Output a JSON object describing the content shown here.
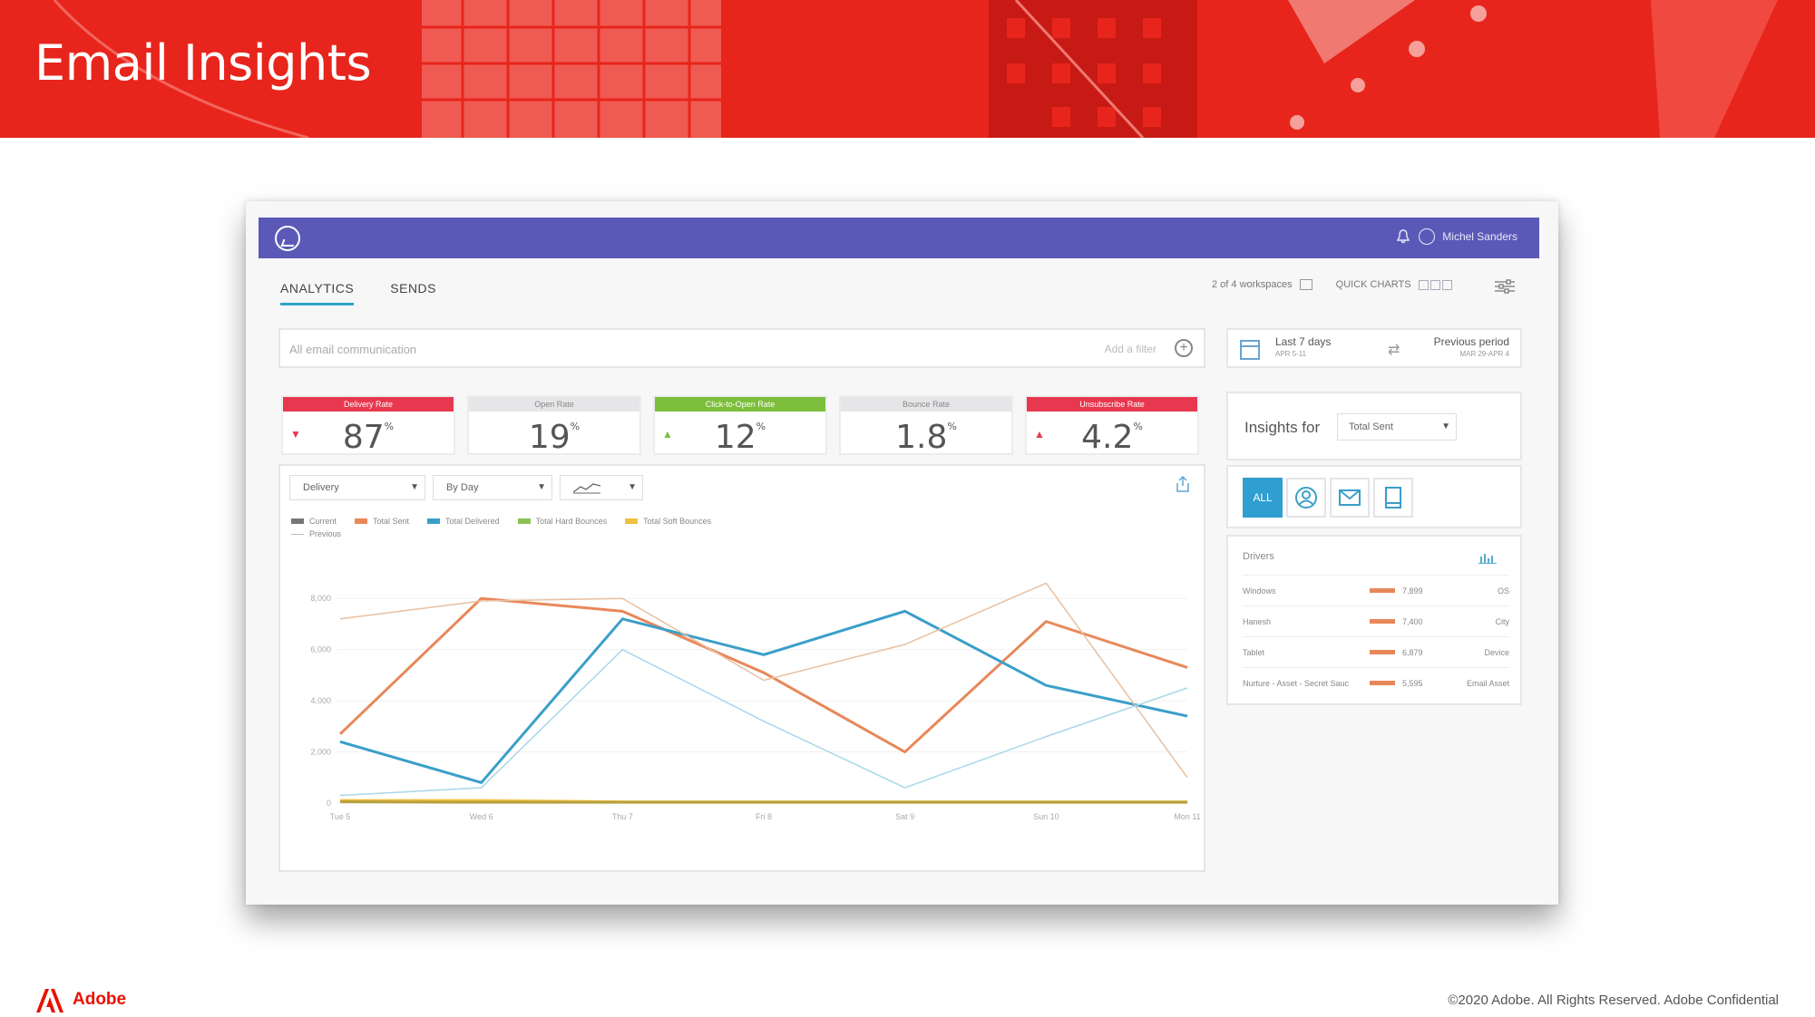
{
  "slide": {
    "title": "Email Insights",
    "brand": "Adobe",
    "copyright": "©2020 Adobe. All Rights Reserved. Adobe Confidential"
  },
  "app": {
    "user": "Michel Sanders",
    "tabs": [
      {
        "label": "ANALYTICS",
        "active": true
      },
      {
        "label": "SENDS",
        "active": false
      }
    ],
    "workspaces": "2 of 4 workspaces",
    "quick_charts": "QUICK CHARTS",
    "filter": {
      "placeholder": "All email communication",
      "add_label": "Add a filter"
    },
    "period": {
      "current": "Last 7 days",
      "current_range": "APR 5-11",
      "previous": "Previous period",
      "previous_range": "MAR 29-APR 4"
    },
    "kpis": [
      {
        "label": "Delivery Rate",
        "value": "87",
        "unit": "%",
        "color": "#e8384f",
        "trend": "down"
      },
      {
        "label": "Open Rate",
        "value": "19",
        "unit": "%",
        "color": "#e6e6e9",
        "trend": ""
      },
      {
        "label": "Click-to-Open Rate",
        "value": "12",
        "unit": "%",
        "color": "#7cbe3b",
        "trend": "up"
      },
      {
        "label": "Bounce Rate",
        "value": "1.8",
        "unit": "%",
        "color": "#e6e6e9",
        "trend": ""
      },
      {
        "label": "Unsubscribe Rate",
        "value": "4.2",
        "unit": "%",
        "color": "#e8384f",
        "trend": "up"
      }
    ],
    "chart_controls": {
      "metric": "Delivery",
      "granularity": "By Day"
    },
    "insights": {
      "label": "Insights for",
      "selected": "Total Sent",
      "all_button": "ALL"
    },
    "drivers": {
      "title": "Drivers",
      "rows": [
        {
          "name": "Windows",
          "value": "7,899",
          "category": "OS"
        },
        {
          "name": "Hanesh",
          "value": "7,400",
          "category": "City"
        },
        {
          "name": "Tablet",
          "value": "6,879",
          "category": "Device"
        },
        {
          "name": "Nurture - Asset - Secret Sauc",
          "value": "5,595",
          "category": "Email Asset"
        }
      ]
    }
  },
  "chart_data": {
    "type": "line",
    "categories": [
      "Tue 5",
      "Wed 6",
      "Thu 7",
      "Fri 8",
      "Sat 9",
      "Sun 10",
      "Mon 11"
    ],
    "ylim": [
      0,
      9000
    ],
    "yticks": [
      "0",
      "2,000",
      "4,000",
      "6,000",
      "8,000"
    ],
    "legend": [
      {
        "name": "Current",
        "color": "#777777"
      },
      {
        "name": "Total Sent",
        "color": "#e8885a"
      },
      {
        "name": "Total Delivered",
        "color": "#3a9fc8"
      },
      {
        "name": "Total Hard Bounces",
        "color": "#8cc152"
      },
      {
        "name": "Total Soft Bounces",
        "color": "#f0c040"
      }
    ],
    "legend_previous": "Previous",
    "series": [
      {
        "name": "Total Sent",
        "color": "#e8885a",
        "style": "current",
        "values": [
          2700,
          8000,
          7500,
          5100,
          2000,
          7100,
          5300
        ]
      },
      {
        "name": "Total Delivered",
        "color": "#3a9fc8",
        "style": "current",
        "values": [
          2400,
          800,
          7200,
          5800,
          7500,
          4600,
          3400
        ]
      },
      {
        "name": "Total Soft Bounces",
        "color": "#f0c040",
        "style": "current",
        "values": [
          100,
          100,
          50,
          50,
          50,
          50,
          50
        ]
      },
      {
        "name": "Total Hard Bounces",
        "color": "#b8a040",
        "style": "current",
        "values": [
          50,
          30,
          30,
          30,
          30,
          30,
          30
        ]
      },
      {
        "name": "Total Sent",
        "color": "#e8c0a0",
        "style": "previous",
        "values": [
          7200,
          7900,
          8000,
          4800,
          6200,
          8600,
          1000
        ]
      },
      {
        "name": "Total Delivered",
        "color": "#a8d8e8",
        "style": "previous",
        "values": [
          300,
          600,
          6000,
          3200,
          600,
          2600,
          4500
        ]
      }
    ]
  }
}
